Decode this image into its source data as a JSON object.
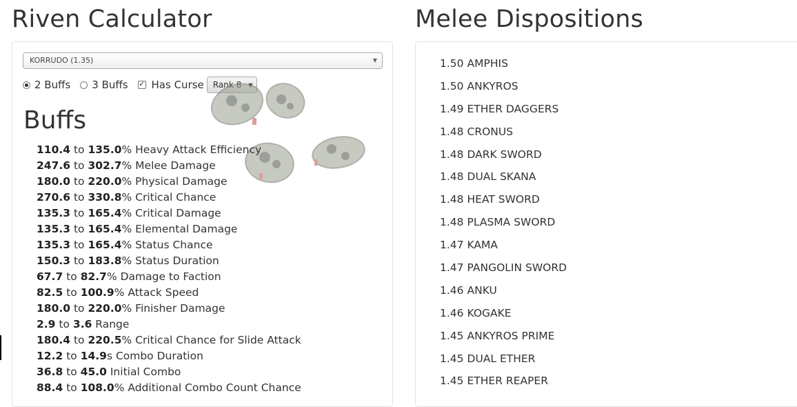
{
  "calculator": {
    "title": "Riven Calculator",
    "weapon_select": {
      "selected": "KORRUDO (1.35)",
      "arrow_icon": "triangle-down"
    },
    "buff_options": [
      {
        "label": "2 Buffs",
        "checked": true
      },
      {
        "label": "3 Buffs",
        "checked": false
      }
    ],
    "curse": {
      "label": "Has Curse",
      "checked": true,
      "check_glyph": "✓"
    },
    "rank_select": {
      "selected": "Rank 8",
      "arrow_icon": "triangle-down"
    },
    "buffs_heading": "Buffs",
    "buffs": [
      {
        "min": "110.4",
        "sep": "to",
        "max": "135.0",
        "text": "% Heavy Attack Efficiency"
      },
      {
        "min": "247.6",
        "sep": "to",
        "max": "302.7",
        "text": "% Melee Damage"
      },
      {
        "min": "180.0",
        "sep": "to",
        "max": "220.0",
        "text": "% Physical Damage"
      },
      {
        "min": "270.6",
        "sep": "to",
        "max": "330.8",
        "text": "% Critical Chance"
      },
      {
        "min": "135.3",
        "sep": "to",
        "max": "165.4",
        "text": "% Critical Damage"
      },
      {
        "min": "135.3",
        "sep": "to",
        "max": "165.4",
        "text": "% Elemental Damage"
      },
      {
        "min": "135.3",
        "sep": "to",
        "max": "165.4",
        "text": "% Status Chance"
      },
      {
        "min": "150.3",
        "sep": "to",
        "max": "183.8",
        "text": "% Status Duration"
      },
      {
        "min": "67.7",
        "sep": "to",
        "max": "82.7",
        "text": "% Damage to Faction"
      },
      {
        "min": "82.5",
        "sep": "to",
        "max": "100.9",
        "text": "% Attack Speed"
      },
      {
        "min": "180.0",
        "sep": "to",
        "max": "220.0",
        "text": "% Finisher Damage"
      },
      {
        "min": "2.9",
        "sep": "to",
        "max": "3.6",
        "text": " Range"
      },
      {
        "min": "180.4",
        "sep": "to",
        "max": "220.5",
        "text": "% Critical Chance for Slide Attack"
      },
      {
        "min": "12.2",
        "sep": "to",
        "max": "14.9",
        "text": "s Combo Duration"
      },
      {
        "min": "36.8",
        "sep": "to",
        "max": "45.0",
        "text": " Initial Combo"
      },
      {
        "min": "88.4",
        "sep": "to",
        "max": "108.0",
        "text": "% Additional Combo Count Chance"
      }
    ]
  },
  "dispositions": {
    "title": "Melee Dispositions",
    "items": [
      {
        "value": "1.50",
        "name": "AMPHIS"
      },
      {
        "value": "1.50",
        "name": "ANKYROS"
      },
      {
        "value": "1.49",
        "name": "ETHER DAGGERS"
      },
      {
        "value": "1.48",
        "name": "CRONUS"
      },
      {
        "value": "1.48",
        "name": "DARK SWORD"
      },
      {
        "value": "1.48",
        "name": "DUAL SKANA"
      },
      {
        "value": "1.48",
        "name": "HEAT SWORD"
      },
      {
        "value": "1.48",
        "name": "PLASMA SWORD"
      },
      {
        "value": "1.47",
        "name": "KAMA"
      },
      {
        "value": "1.47",
        "name": "PANGOLIN SWORD"
      },
      {
        "value": "1.46",
        "name": "ANKU"
      },
      {
        "value": "1.46",
        "name": "KOGAKE"
      },
      {
        "value": "1.45",
        "name": "ANKYROS PRIME"
      },
      {
        "value": "1.45",
        "name": "DUAL ETHER"
      },
      {
        "value": "1.45",
        "name": "ETHER REAPER"
      }
    ]
  },
  "colors": {
    "text": "#333333",
    "border": "#e3e3e3",
    "background": "#ffffff"
  }
}
